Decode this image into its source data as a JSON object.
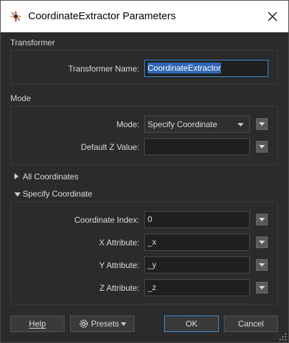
{
  "window": {
    "title": "CoordinateExtractor Parameters",
    "close_icon": "close-icon",
    "app_icon": "fme-transformer-icon"
  },
  "transformer": {
    "section_label": "Transformer",
    "name_label": "Transformer Name:",
    "name_value": "CoordinateExtractor"
  },
  "mode": {
    "section_label": "Mode",
    "mode_label": "Mode:",
    "mode_value": "Specify Coordinate",
    "default_z_label": "Default Z Value:",
    "default_z_value": ""
  },
  "all_coordinates": {
    "label": "All Coordinates",
    "expanded": false
  },
  "specify_coordinate": {
    "label": "Specify Coordinate",
    "expanded": true,
    "index_label": "Coordinate Index:",
    "index_value": "0",
    "x_label": "X Attribute:",
    "x_value": "_x",
    "y_label": "Y Attribute:",
    "y_value": "_y",
    "z_label": "Z Attribute:",
    "z_value": "_z"
  },
  "buttons": {
    "help": "Help",
    "presets": "Presets",
    "ok": "OK",
    "cancel": "Cancel"
  },
  "colors": {
    "background": "#2b2b2b",
    "accent": "#3d8fd6",
    "selection": "#2f66b3"
  }
}
